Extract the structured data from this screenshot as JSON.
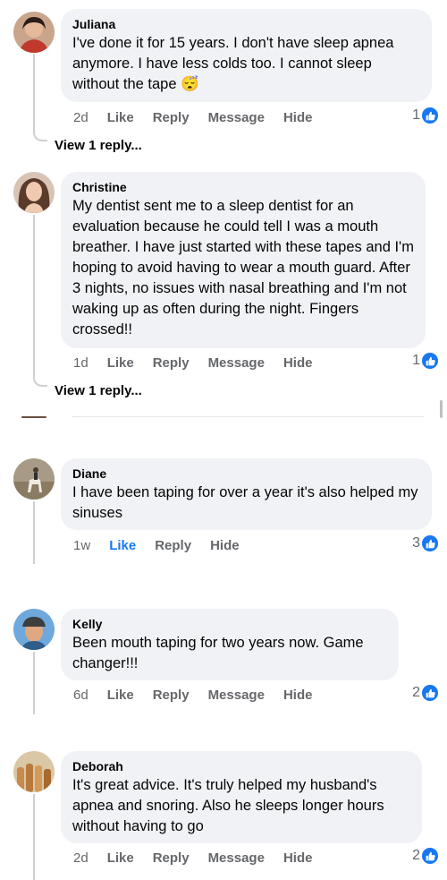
{
  "comments": [
    {
      "author": "Juliana",
      "text": "I've done it for 15 years. I don't have sleep apnea anymore. I have less colds too. I cannot sleep without the tape",
      "emoji": "😴",
      "time": "2d",
      "actions": [
        "Like",
        "Reply",
        "Message",
        "Hide"
      ],
      "reactions": "1",
      "replies_label": "View 1 reply..."
    },
    {
      "author": "Christine",
      "text": "My dentist sent me to a sleep dentist for an evaluation because he could tell I was a mouth breather.  I have just started with these tapes and I'm hoping to avoid having to wear a mouth guard.  After 3 nights, no issues with nasal breathing and I'm not waking up as often during the night.  Fingers crossed!!",
      "time": "1d",
      "actions": [
        "Like",
        "Reply",
        "Message",
        "Hide"
      ],
      "reactions": "1",
      "replies_label": "View 1 reply..."
    },
    {
      "author": "Diane",
      "text": "I have been taping for over a year it's also helped my sinuses",
      "time": "1w",
      "actions": [
        "Like",
        "Reply",
        "Hide"
      ],
      "reactions": "3"
    },
    {
      "author": "Kelly",
      "text": "Been mouth taping for two years now. Game changer!!!",
      "time": "6d",
      "actions": [
        "Like",
        "Reply",
        "Message",
        "Hide"
      ],
      "reactions": "2"
    },
    {
      "author": "Deborah",
      "text": "It's great advice. It's truly helped my husband's apnea and snoring. Also he sleeps longer hours without having to go",
      "time": "2d",
      "actions": [
        "Like",
        "Reply",
        "Message",
        "Hide"
      ],
      "reactions": "2"
    }
  ],
  "colors": {
    "like_blue": "#1877f2",
    "bubble_bg": "#f0f2f5",
    "meta_gray": "#65676b"
  },
  "icons": {
    "like": "thumbs-up-icon"
  }
}
